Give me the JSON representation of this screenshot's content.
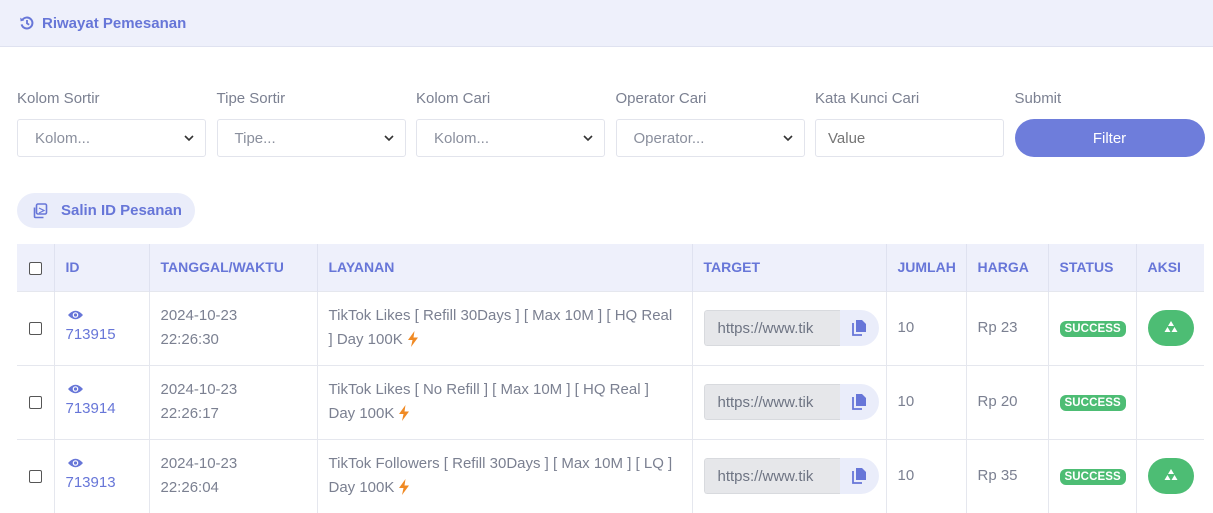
{
  "header": {
    "title": "Riwayat Pemesanan",
    "icon": "history-icon"
  },
  "filters": {
    "sort_column": {
      "label": "Kolom Sortir",
      "value": "Kolom..."
    },
    "sort_type": {
      "label": "Tipe Sortir",
      "value": "Tipe..."
    },
    "search_column": {
      "label": "Kolom Cari",
      "value": "Kolom..."
    },
    "search_operator": {
      "label": "Operator Cari",
      "value": "Operator..."
    },
    "keyword": {
      "label": "Kata Kunci Cari",
      "placeholder": "Value"
    },
    "submit": {
      "label": "Submit",
      "button": "Filter"
    }
  },
  "copy_ids_button": "Salin ID Pesanan",
  "table": {
    "headers": [
      "ID",
      "TANGGAL/WAKTU",
      "LAYANAN",
      "TARGET",
      "JUMLAH",
      "HARGA",
      "STATUS",
      "AKSI"
    ],
    "rows": [
      {
        "id": "713915",
        "date": "2024-10-23",
        "time": "22:26:30",
        "service": "TikTok Likes [ Refill 30Days ] [ Max 10M ] [ HQ Real ] Day 100K",
        "target": "https://www.tik",
        "qty": "10",
        "price": "Rp 23",
        "status": "SUCCESS",
        "refill": true
      },
      {
        "id": "713914",
        "date": "2024-10-23",
        "time": "22:26:17",
        "service": "TikTok Likes [ No Refill ] [ Max 10M ] [ HQ Real ] Day 100K",
        "target": "https://www.tik",
        "qty": "10",
        "price": "Rp 20",
        "status": "SUCCESS",
        "refill": false
      },
      {
        "id": "713913",
        "date": "2024-10-23",
        "time": "22:26:04",
        "service": "TikTok Followers [ Refill 30Days ] [ Max 10M ] [ LQ ] Day 100K",
        "target": "https://www.tik",
        "qty": "10",
        "price": "Rp 35",
        "status": "SUCCESS",
        "refill": true
      }
    ]
  },
  "colors": {
    "accent": "#6e7ddb",
    "success": "#4dbd74",
    "bolt": "#f08a24",
    "header_bg": "#eef0fb"
  }
}
